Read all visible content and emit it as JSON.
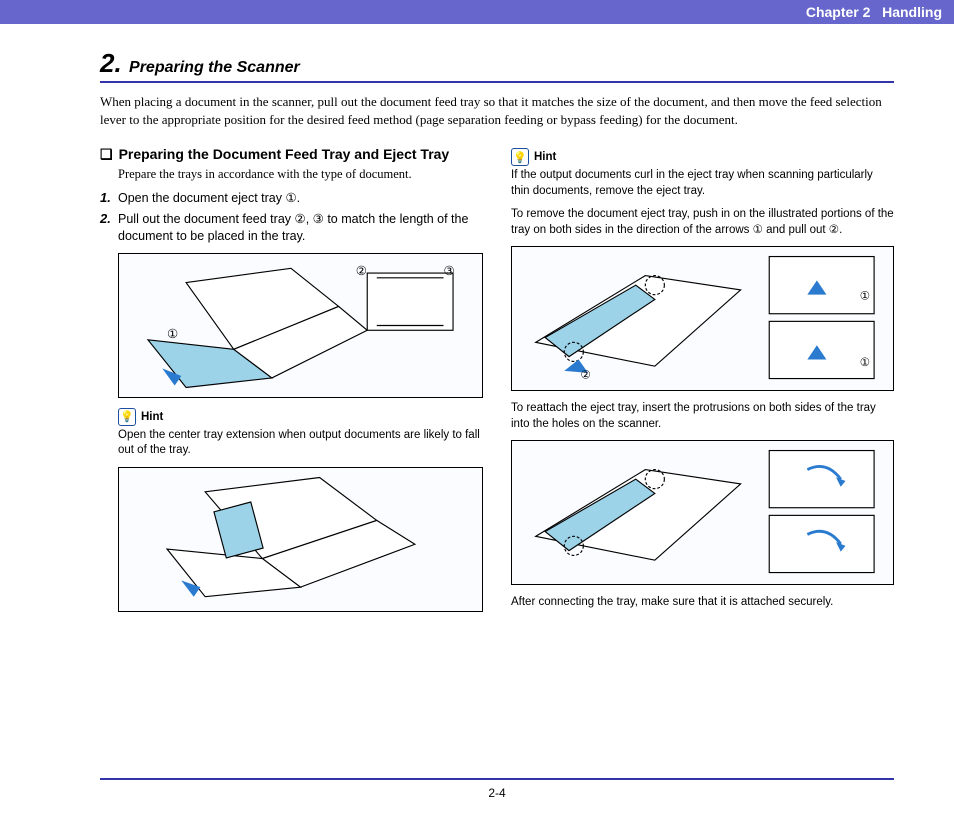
{
  "header": {
    "chapter": "Chapter 2",
    "title": "Handling"
  },
  "section": {
    "number": "2.",
    "name": "Preparing the Scanner"
  },
  "intro": "When placing a document in the scanner, pull out the document feed tray so that it matches the size of the document, and then move the feed selection lever to the appropriate position for the desired feed method (page separation feeding or bypass feeding) for the document.",
  "left": {
    "sub_bullet": "❏",
    "subheading": "Preparing the Document Feed Tray and Eject Tray",
    "sub_desc": "Prepare the trays in accordance with the type of document.",
    "steps": [
      {
        "num": "1.",
        "text": "Open the document eject tray ①."
      },
      {
        "num": "2.",
        "text": "Pull out the document feed tray ②, ③ to match the length of the document to be placed in the tray."
      }
    ],
    "hint_label": "Hint",
    "hint_text": "Open the center tray extension when output documents are likely to fall out of the tray."
  },
  "right": {
    "hint_label": "Hint",
    "hint_text": "If the output documents curl in the eject tray when scanning particularly thin documents, remove the eject tray.",
    "remove_text": "To remove the document eject tray, push in on the illustrated portions of the tray on both sides in the direction of the arrows ① and pull out ②.",
    "reattach_text": "To reattach the eject tray, insert the protrusions on both sides of the tray into the holes on the scanner.",
    "secure_text": "After connecting the tray, make sure that it is attached securely."
  },
  "footer": {
    "page": "2-4"
  },
  "labels": {
    "c1": "①",
    "c2": "②",
    "c3": "③"
  }
}
